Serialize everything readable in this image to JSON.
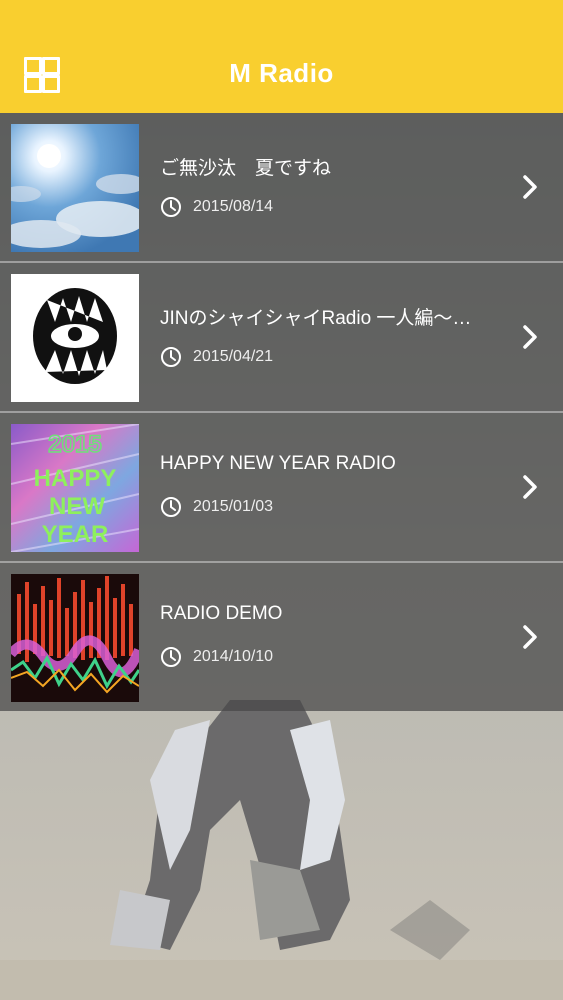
{
  "app": {
    "title": "M Radio"
  },
  "header": {
    "menu_icon": "grid-icon"
  },
  "colors": {
    "header_bg": "#f9cf2f",
    "header_text": "#ffffff",
    "list_overlay": "rgba(70,70,70,0.72)"
  },
  "episodes": [
    {
      "title": "ご無沙汰　夏ですね",
      "date": "2015/08/14",
      "thumb_icon": "sky-sun-thumbnail"
    },
    {
      "title": "JINのシャイシャイRadio 一人編〜…",
      "date": "2015/04/21",
      "thumb_icon": "monster-mouth-thumbnail"
    },
    {
      "title": "HAPPY NEW YEAR RADIO",
      "date": "2015/01/03",
      "thumb_icon": "happy-new-year-thumbnail",
      "thumb_text": [
        "2015",
        "HAPPY",
        "NEW",
        "YEAR"
      ]
    },
    {
      "title": "RADIO DEMO",
      "date": "2014/10/10",
      "thumb_icon": "waveform-thumbnail"
    }
  ]
}
